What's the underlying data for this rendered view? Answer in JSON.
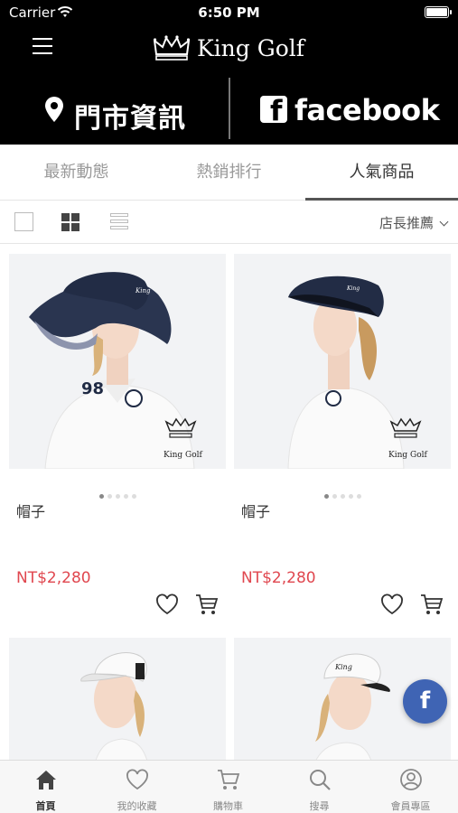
{
  "status_bar": {
    "carrier": "Carrier",
    "time": "6:50 PM"
  },
  "header": {
    "brand": "King Golf",
    "store_info": "門市資訊",
    "facebook": "facebook"
  },
  "tabs": [
    {
      "label": "最新動態",
      "active": false
    },
    {
      "label": "熱銷排行",
      "active": false
    },
    {
      "label": "人氣商品",
      "active": true
    }
  ],
  "toolbar": {
    "sort_label": "店長推薦"
  },
  "products": [
    {
      "name": "帽子",
      "price": "NT$2,280",
      "logo_text": "King Golf",
      "shirt_number": "98"
    },
    {
      "name": "帽子",
      "price": "NT$2,280",
      "logo_text": "King Golf"
    },
    {
      "name": "",
      "price": ""
    },
    {
      "name": "",
      "price": ""
    }
  ],
  "bottom_nav": [
    {
      "label": "首頁",
      "icon": "home-icon",
      "active": true
    },
    {
      "label": "我的收藏",
      "icon": "heart-icon",
      "active": false
    },
    {
      "label": "購物車",
      "icon": "cart-icon",
      "active": false
    },
    {
      "label": "搜尋",
      "icon": "search-icon",
      "active": false
    },
    {
      "label": "會員專區",
      "icon": "user-icon",
      "active": false
    }
  ],
  "colors": {
    "header_bg": "#000000",
    "price": "#e0474f",
    "fab": "#3f64b4"
  }
}
